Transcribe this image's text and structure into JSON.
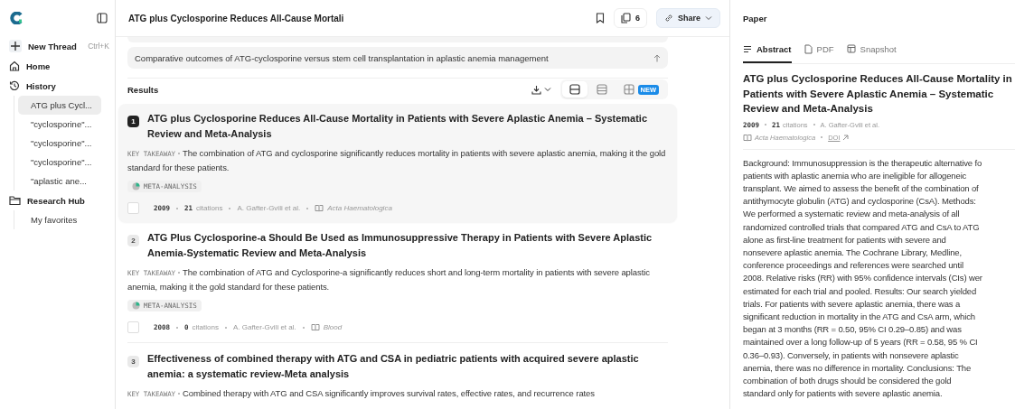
{
  "sidebar": {
    "items": [
      {
        "kind": "new",
        "label": "New Thread",
        "shortcut": "Ctrl+K"
      },
      {
        "kind": "home",
        "label": "Home"
      },
      {
        "kind": "history",
        "label": "History",
        "children": [
          {
            "label": "ATG plus Cycl...",
            "selected": true
          },
          {
            "label": "\"cyclosporine\"...",
            "selected": false
          },
          {
            "label": "\"cyclosporine\"...",
            "selected": false
          },
          {
            "label": "\"cyclosporine\"...",
            "selected": false
          },
          {
            "label": "\"aplastic ane...",
            "selected": false
          }
        ]
      },
      {
        "kind": "hub",
        "label": "Research Hub",
        "children": [
          {
            "label": "My favorites",
            "selected": false
          }
        ]
      }
    ]
  },
  "header": {
    "title": "ATG plus Cyclosporine Reduces All-Cause Mortali",
    "count": "6",
    "share": "Share"
  },
  "query": {
    "text": "Comparative outcomes of ATG-cyclosporine versus stem cell transplantation in aplastic anemia management"
  },
  "results": {
    "heading": "Results",
    "view_modes": [
      {
        "kind": "list",
        "selected": true
      },
      {
        "kind": "compact",
        "selected": false
      },
      {
        "kind": "table",
        "selected": false,
        "badge": "NEW"
      }
    ],
    "items": [
      {
        "number": "1",
        "selected": true,
        "title": "ATG plus Cyclosporine Reduces All-Cause Mortality in Patients with Severe Aplastic Anemia – Systematic Review and Meta-Analysis",
        "takeaway_label": "KEY TAKEAWAY",
        "takeaway": "The combination of ATG and cyclosporine significantly reduces mortality in patients with severe aplastic anemia, making it the gold standard for these patients.",
        "checked": false,
        "tag": "META-ANALYSIS",
        "year": "2009",
        "citations": "21",
        "citations_label": "citations",
        "authors": "A. Gafter-Gvili et al.",
        "journal": "Acta Haematologica"
      },
      {
        "number": "2",
        "selected": false,
        "title": "ATG Plus Cyclosporine-a Should Be Used as Immunosuppressive Therapy in Patients with Severe Aplastic Anemia-Systematic Review and Meta-Analysis",
        "takeaway_label": "KEY TAKEAWAY",
        "takeaway": "The combination of ATG and Cyclosporine-a significantly reduces short and long-term mortality in patients with severe aplastic anemia, making it the gold standard for these patients.",
        "checked": false,
        "tag": "META-ANALYSIS",
        "year": "2008",
        "citations": "0",
        "citations_label": "citations",
        "authors": "A. Gafter-Gvili et al.",
        "journal": "Blood"
      },
      {
        "number": "3",
        "selected": false,
        "title": "Effectiveness of combined therapy with ATG and CSA in pediatric patients with acquired severe aplastic anemia: a systematic review-Meta analysis",
        "takeaway_label": "KEY TAKEAWAY",
        "takeaway": "Combined therapy with ATG and CSA significantly improves survival rates, effective rates, and recurrence rates"
      }
    ]
  },
  "paper": {
    "heading": "Paper",
    "tabs": [
      {
        "kind": "abstract",
        "label": "Abstract",
        "selected": true
      },
      {
        "kind": "pdf",
        "label": "PDF",
        "selected": false
      },
      {
        "kind": "snapshot",
        "label": "Snapshot",
        "selected": false
      }
    ],
    "title_lines": [
      "ATG plus Cyclosporine Reduces All-Cause Mortality in",
      "Patients with Severe Aplastic Anemia – Systematic",
      "Review and Meta-Analysis"
    ],
    "year": "2009",
    "citations": "21",
    "citations_label": "citations",
    "authors": "A. Gafter-Gvili et al.",
    "journal": "Acta Haematologica",
    "doi": "DOI",
    "abstract_lines": [
      "Background: Immunosuppression is the therapeutic alternative fo",
      "patients with aplastic anemia who are ineligible for allogeneic",
      "transplant. We aimed to assess the benefit of the combination of",
      "antithymocyte globulin (ATG) and cyclosporine (CsA). Methods:",
      "We performed a systematic review and meta-analysis of all",
      "randomized controlled trials that compared ATG and CsA to ATG",
      "alone as first-line treatment for patients with severe and",
      "nonsevere aplastic anemia. The Cochrane Library, Medline,",
      "conference proceedings and references were searched until",
      "2008. Relative risks (RR) with 95% confidence intervals (CIs) wer",
      "estimated for each trial and pooled. Results: Our search yielded",
      "trials. For patients with severe aplastic anemia, there was a",
      "significant reduction in mortality in the ATG and CsA arm, which",
      "began at 3 months (RR = 0.50, 95% CI 0.29–0.85) and was",
      "maintained over a long follow-up of 5 years (RR = 0.58, 95 % CI",
      "0.36–0.93). Conversely, in patients with nonsevere aplastic",
      "anemia, there was no difference in mortality. Conclusions: The",
      "combination of both drugs should be considered the gold",
      "standard only for patients with severe aplastic anemia."
    ]
  }
}
